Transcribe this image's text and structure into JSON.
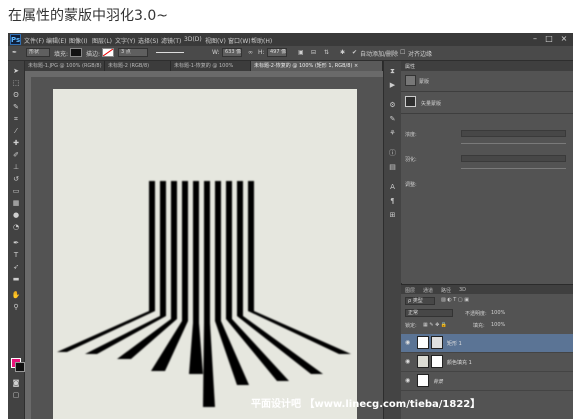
{
  "caption": "在属性的蒙版中羽化3.0~",
  "app_logo": "Ps",
  "menu": [
    "文件(F)",
    "编辑(E)",
    "图像(I)",
    "图层(L)",
    "文字(Y)",
    "选择(S)",
    "滤镜(T)",
    "3D(D)",
    "视图(V)",
    "窗口(W)",
    "帮助(H)"
  ],
  "options": {
    "shape_mode": "形状",
    "fill_label": "填充:",
    "stroke_label": "描边:",
    "stroke_width": "3 点",
    "w_label": "W:",
    "w_value": "633 像",
    "h_label": "H:",
    "h_value": "497 像",
    "auto_add_delete": "自动添加/删除",
    "align_edges": "对齐边缘"
  },
  "tabs": [
    {
      "label": "未标题-1.JPG @ 100% (RGB/8)",
      "active": false
    },
    {
      "label": "未标题-2 (RGB/8)",
      "active": false
    },
    {
      "label": "未标题-1-恢复的 @ 100%",
      "active": false
    },
    {
      "label": "未标题-2-恢复的 @ 100% (矩形 1, RGB/8) ×",
      "active": true
    }
  ],
  "properties": {
    "title": "属性",
    "mask_label": "蒙版",
    "vector_mask": "矢量蒙版",
    "density_label": "浓度:",
    "feather_label": "羽化:",
    "refine_label": "调整:"
  },
  "layers": {
    "tabs": [
      "图层",
      "通道",
      "路径",
      "3D"
    ],
    "kind_filter": "ρ 类型",
    "blend_mode": "正常",
    "opacity_label": "不透明度:",
    "opacity_value": "100%",
    "lock_label": "锁定:",
    "fill_label": "填充:",
    "fill_value": "100%",
    "items": [
      {
        "name": "矩形 1",
        "selected": true
      },
      {
        "name": "颜色填充 1",
        "selected": false
      },
      {
        "name": "背景",
        "selected": false
      }
    ]
  },
  "watermark": "平面设计吧 【www.linecg.com/tieba/1822】",
  "colors": {
    "foreground": "#e8137a",
    "background": "#111111",
    "canvas": "#e6e7df"
  }
}
